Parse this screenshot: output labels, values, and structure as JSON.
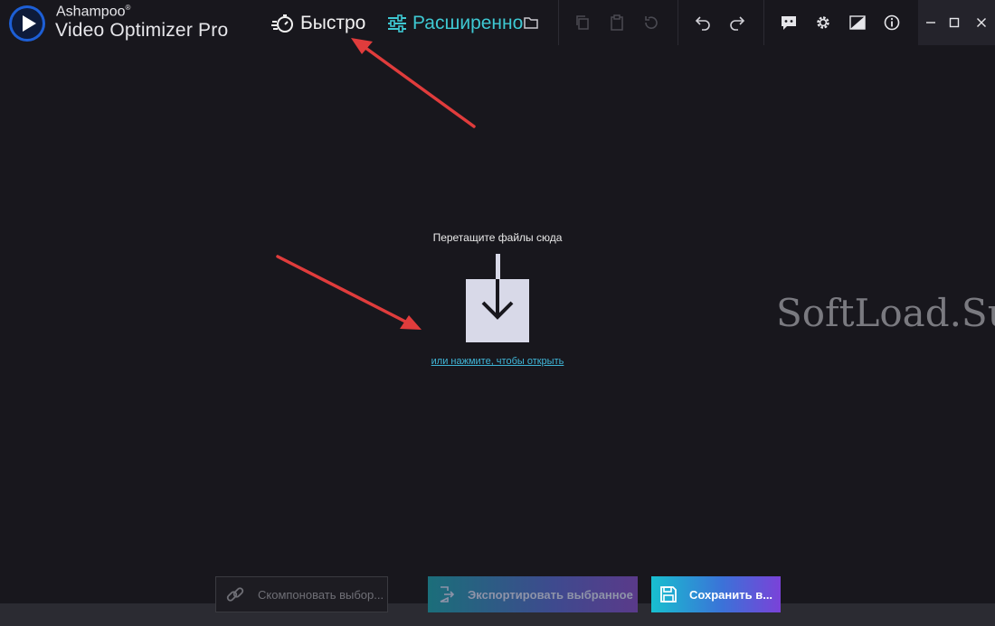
{
  "app": {
    "brand_small": "Ashampoo",
    "brand_mark": "®",
    "brand_big": "Video Optimizer Pro"
  },
  "modes": {
    "fast_label": "Быстро",
    "advanced_label": "Расширенно"
  },
  "drop_zone": {
    "hint": "Перетащите файлы сюда",
    "open_link": "или нажмите, чтобы открыть"
  },
  "bottom": {
    "compose_label": "Скомпоновать выбор...",
    "export_label": "Экспортировать выбранное",
    "save_label": "Сохранить в..."
  },
  "watermark": "SoftLoad.Su",
  "colors": {
    "background": "#18171d",
    "accent_cyan": "#3ec8d2",
    "link": "#3fb6d8",
    "annotation_arrow": "#e03c3c"
  },
  "icons": {
    "fast": "stopwatch-icon",
    "advanced": "sliders-icon",
    "folder": "folder-icon",
    "copy": "copy-icon",
    "paste": "clipboard-icon",
    "reset": "reset-icon",
    "undo": "undo-icon",
    "redo": "redo-icon",
    "feedback": "chat-icon",
    "settings": "gear-icon",
    "theme": "theme-icon",
    "info": "info-icon",
    "minimize": "minimize-icon",
    "maximize": "maximize-icon",
    "close": "close-icon",
    "link": "link-icon",
    "export": "export-icon",
    "save": "save-icon"
  }
}
